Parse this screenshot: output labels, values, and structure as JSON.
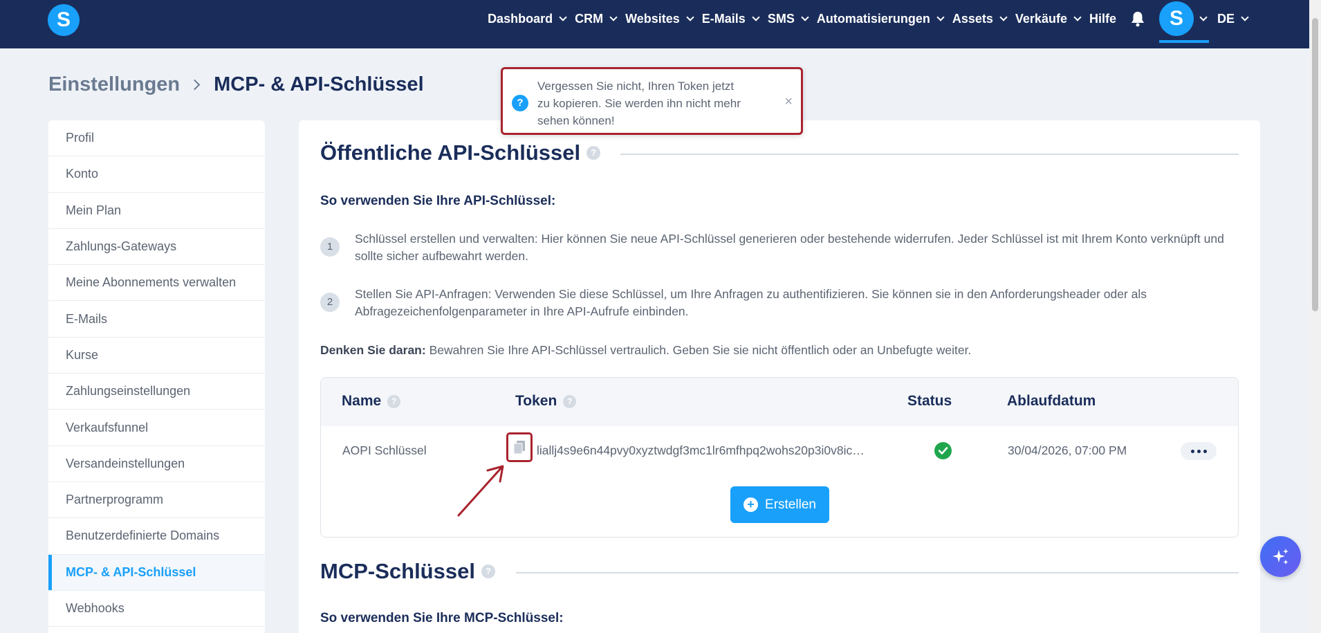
{
  "nav": {
    "items": [
      {
        "label": "Dashboard",
        "has_caret": true
      },
      {
        "label": "CRM",
        "has_caret": true
      },
      {
        "label": "Websites",
        "has_caret": true
      },
      {
        "label": "E-Mails",
        "has_caret": true
      },
      {
        "label": "SMS",
        "has_caret": true
      },
      {
        "label": "Automatisierungen",
        "has_caret": true
      },
      {
        "label": "Assets",
        "has_caret": true
      },
      {
        "label": "Verkäufe",
        "has_caret": true
      },
      {
        "label": "Hilfe",
        "has_caret": false
      }
    ],
    "logo_letter": "S",
    "avatar_letter": "S",
    "language": "DE",
    "bell_icon": "bell-icon"
  },
  "breadcrumb": {
    "parent": "Einstellungen",
    "current": "MCP- & API-Schlüssel"
  },
  "toast": {
    "icon": "?",
    "message": "Vergessen Sie nicht, Ihren Token jetzt zu kopieren. Sie werden ihn nicht mehr sehen können!",
    "close": "×"
  },
  "sidebar": {
    "items": [
      {
        "label": "Profil",
        "active": false
      },
      {
        "label": "Konto",
        "active": false
      },
      {
        "label": "Mein Plan",
        "active": false
      },
      {
        "label": "Zahlungs-Gateways",
        "active": false
      },
      {
        "label": "Meine Abonnements verwalten",
        "active": false
      },
      {
        "label": "E-Mails",
        "active": false
      },
      {
        "label": "Kurse",
        "active": false
      },
      {
        "label": "Zahlungseinstellungen",
        "active": false
      },
      {
        "label": "Verkaufsfunnel",
        "active": false
      },
      {
        "label": "Versandeinstellungen",
        "active": false
      },
      {
        "label": "Partnerprogramm",
        "active": false
      },
      {
        "label": "Benutzerdefinierte Domains",
        "active": false
      },
      {
        "label": "MCP- & API-Schlüssel",
        "active": true
      },
      {
        "label": "Webhooks",
        "active": false
      }
    ]
  },
  "api_section": {
    "title": "Öffentliche API-Schlüssel",
    "howto": "So verwenden Sie Ihre API-Schlüssel:",
    "steps": [
      {
        "num": "1",
        "text": "Schlüssel erstellen und verwalten: Hier können Sie neue API-Schlüssel generieren oder bestehende widerrufen. Jeder Schlüssel ist mit Ihrem Konto verknüpft und sollte sicher aufbewahrt werden."
      },
      {
        "num": "2",
        "text": "Stellen Sie API-Anfragen: Verwenden Sie diese Schlüssel, um Ihre Anfragen zu authentifizieren. Sie können sie in den Anforderungsheader oder als Abfragezeichenfolgenparameter in Ihre API-Aufrufe einbinden."
      }
    ],
    "note_bold": "Denken Sie daran:",
    "note_text": " Bewahren Sie Ihre API-Schlüssel vertraulich. Geben Sie sie nicht öffentlich oder an Unbefugte weiter.",
    "table": {
      "headers": {
        "name": "Name",
        "token": "Token",
        "status": "Status",
        "expiry": "Ablaufdatum"
      },
      "rows": [
        {
          "name": "AOPI Schlüssel",
          "token": "liallj4s9e6n44pvy0xyztwdgf3mc1lr6mfhpq2wohs20p3i0v8ic…",
          "status": "active",
          "expiry": "30/04/2026, 07:00 PM"
        }
      ],
      "create_label": "Erstellen"
    }
  },
  "mcp_section": {
    "title": "MCP-Schlüssel",
    "howto": "So verwenden Sie Ihre MCP-Schlüssel:"
  },
  "colors": {
    "nav_bg": "#1a2d5a",
    "accent": "#18a0fb",
    "annotation": "#a8232e",
    "success": "#1fa64d"
  }
}
